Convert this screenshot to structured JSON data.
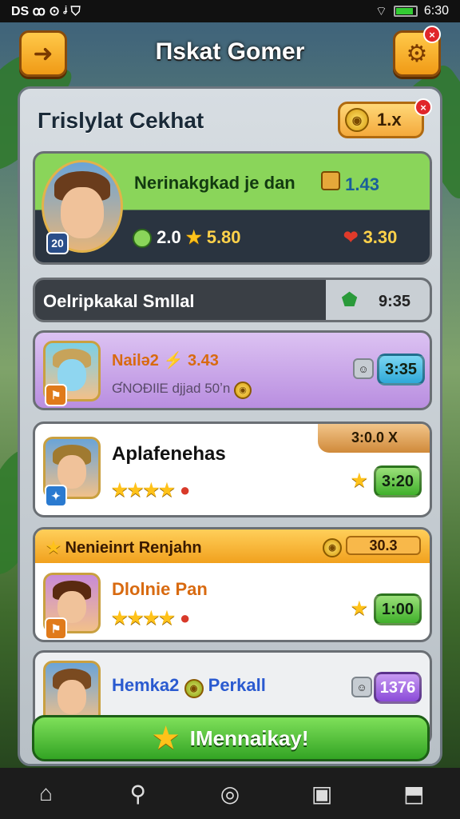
{
  "status_bar": {
    "left_glyphs": "DS  ꝏ  ⊙  ᶨ  ⛉",
    "time": "6:30"
  },
  "header": {
    "back_icon": "back-arrow-icon",
    "title": "Πskat Gomer",
    "settings_icon": "gear-icon",
    "settings_badge": "×"
  },
  "panel": {
    "title": "Γrislylat Cekhat",
    "multiplier": "1.x",
    "multiplier_badge": "×"
  },
  "featured": {
    "name": "Nerinakgkad je dan",
    "value": "1.43",
    "level": "20",
    "coins": "2.0",
    "stars": "5.80",
    "rating": "3.30"
  },
  "search_bar": {
    "text": "Oelripkakal Smllal",
    "value": "9:35"
  },
  "entries": [
    {
      "name": "Nailə2",
      "value": "3.43",
      "sub": "ƓNOƉIlE djjad 50ʼn",
      "button": "3:35",
      "color": "#d7b7ef"
    },
    {
      "name": "Aplafenehas",
      "tag": "3:0.0 X",
      "stars": "★★★★",
      "button": "3:20",
      "color": "#ffffff"
    }
  ],
  "section": {
    "header": "Nenieinrt Renjahn",
    "value": "30.3",
    "entry": {
      "name": "Dlolnie Pan",
      "stars": "★★★★",
      "button": "1:00"
    }
  },
  "bottom_entry": {
    "name": "Hemka2",
    "name2": "Perkall",
    "button": "1376"
  },
  "cta": {
    "label": "IMennaikay!"
  },
  "nav": [
    {
      "icon": "home-icon",
      "glyph": "⌂"
    },
    {
      "icon": "map-pin-icon",
      "glyph": "⚲"
    },
    {
      "icon": "circle-icon",
      "glyph": "◎"
    },
    {
      "icon": "chat-icon",
      "glyph": "▣"
    },
    {
      "icon": "share-icon",
      "glyph": "⬒"
    }
  ]
}
